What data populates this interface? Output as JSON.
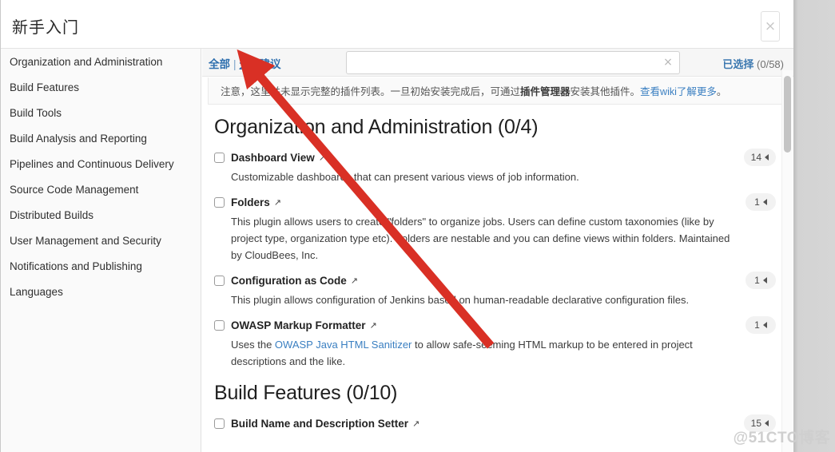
{
  "window": {
    "title": "新手入门",
    "close_label": "×",
    "watermark": "@51CTO博客"
  },
  "sidebar": {
    "items": [
      {
        "label": "Organization and Administration"
      },
      {
        "label": "Build Features"
      },
      {
        "label": "Build Tools"
      },
      {
        "label": "Build Analysis and Reporting"
      },
      {
        "label": "Pipelines and Continuous Delivery"
      },
      {
        "label": "Source Code Management"
      },
      {
        "label": "Distributed Builds"
      },
      {
        "label": "User Management and Security"
      },
      {
        "label": "Notifications and Publishing"
      },
      {
        "label": "Languages"
      }
    ]
  },
  "filter_bar": {
    "all_label": "全部",
    "none_label": "无",
    "suggested_label": "建议",
    "separator": "|",
    "search_value": "",
    "search_placeholder": "",
    "clear_icon": "×",
    "selected_label": "已选择",
    "selected_count": "(0/58)"
  },
  "notice": {
    "prefix": "注意，这里并未显示完整的插件列表。一旦初始安装完成后，可通过",
    "bold": "插件管理器",
    "middle": "安装其他插件。",
    "link": "查看wiki了解更多",
    "suffix": "。"
  },
  "groups": [
    {
      "title": "Organization and Administration (0/4)",
      "plugins": [
        {
          "name": "Dashboard View",
          "ext_icon": "↗",
          "badge": "14",
          "desc_prefix": "Customizable dashboards that can present various views of job information.",
          "desc_link": "",
          "desc_suffix": ""
        },
        {
          "name": "Folders",
          "ext_icon": "↗",
          "badge": "1",
          "desc_prefix": "This plugin allows users to create \"folders\" to organize jobs. Users can define custom taxonomies (like by project type, organization type etc). Folders are nestable and you can define views within folders. Maintained by CloudBees, Inc.",
          "desc_link": "",
          "desc_suffix": ""
        },
        {
          "name": "Configuration as Code",
          "ext_icon": "↗",
          "badge": "1",
          "desc_prefix": "This plugin allows configuration of Jenkins based on human-readable declarative configuration files.",
          "desc_link": "",
          "desc_suffix": ""
        },
        {
          "name": "OWASP Markup Formatter",
          "ext_icon": "↗",
          "badge": "1",
          "desc_prefix": "Uses the ",
          "desc_link": "OWASP Java HTML Sanitizer",
          "desc_suffix": " to allow safe-seeming HTML markup to be entered in project descriptions and the like."
        }
      ]
    },
    {
      "title": "Build Features (0/10)",
      "plugins": [
        {
          "name": "Build Name and Description Setter",
          "ext_icon": "↗",
          "badge": "15",
          "desc_prefix": "",
          "desc_link": "",
          "desc_suffix": ""
        }
      ]
    }
  ],
  "annotation": {
    "color": "#d93025"
  }
}
